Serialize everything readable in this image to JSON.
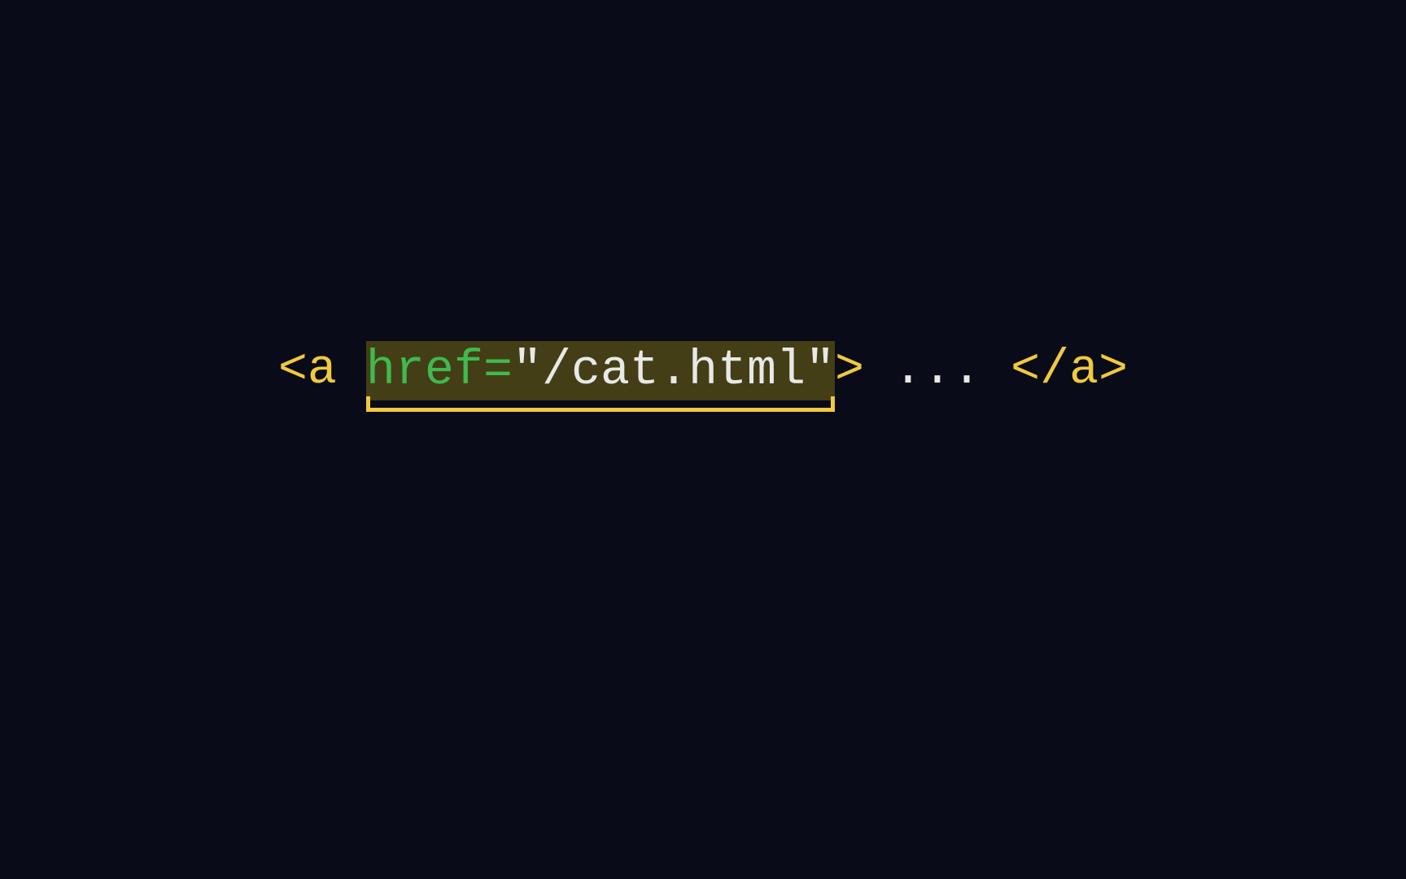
{
  "code": {
    "open_bracket": "<",
    "tag_name": "a",
    "space": " ",
    "attr_name": "href",
    "attr_equals": "=",
    "attr_value": "\"/cat.html\"",
    "close_bracket": ">",
    "content": " ... ",
    "close_open_bracket": "</",
    "close_tag_name": "a",
    "final_bracket": ">"
  }
}
